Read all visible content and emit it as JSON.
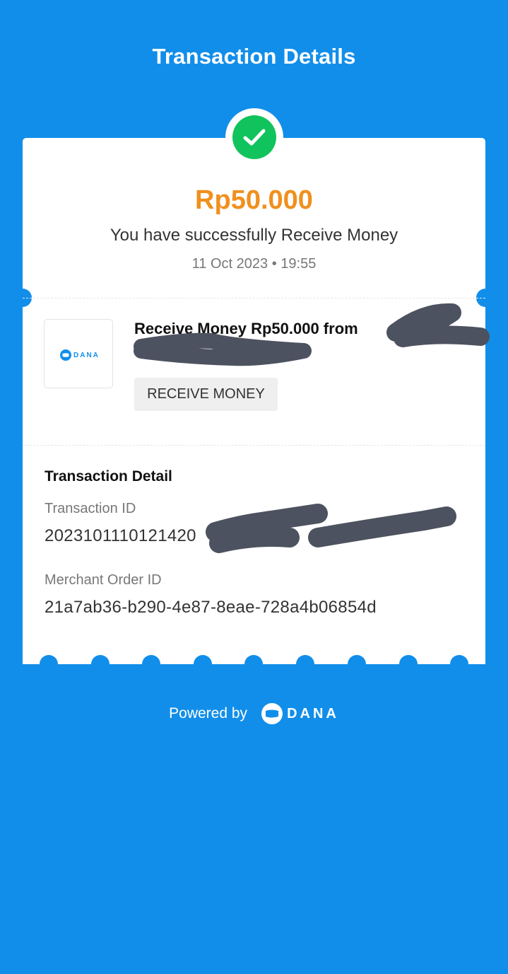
{
  "header": {
    "title": "Transaction Details"
  },
  "summary": {
    "amount": "Rp50.000",
    "message": "You have successfully Receive Money",
    "datetime": "11 Oct 2023 • 19:55",
    "status_icon": "check-icon",
    "status_color": "#11C35C"
  },
  "item": {
    "logo_text": "DANA",
    "title": "Receive Money Rp50.000 from",
    "type": "RECEIVE MONEY"
  },
  "details": {
    "section_title": "Transaction Detail",
    "transaction_id_label": "Transaction ID",
    "transaction_id_value": "2023101110121420",
    "merchant_order_id_label": "Merchant Order ID",
    "merchant_order_id_value": "21a7ab36-b290-4e87-8eae-728a4b06854d"
  },
  "footer": {
    "powered_by": "Powered by",
    "brand": "DANA"
  },
  "colors": {
    "background": "#118EEA",
    "amount": "#F0901E",
    "success": "#11C35C",
    "redaction": "#4D5260"
  }
}
